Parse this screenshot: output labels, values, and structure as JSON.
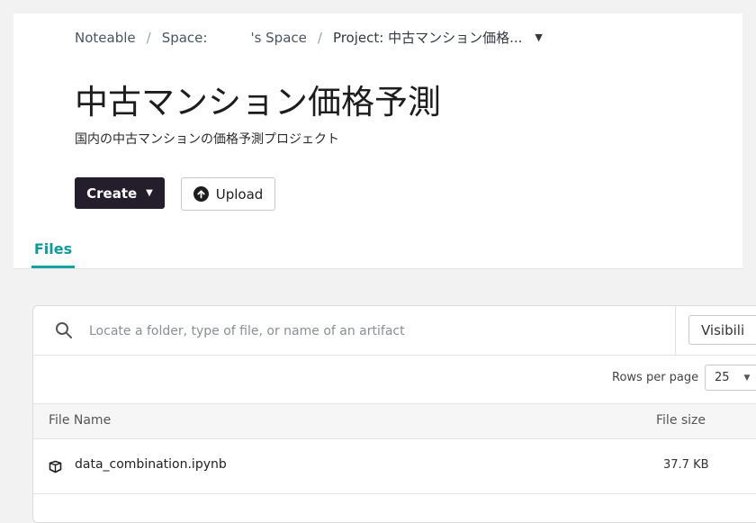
{
  "breadcrumb": {
    "home": "Noteable",
    "separator": "/",
    "space_prefix": "Space:",
    "space_suffix": "'s Space",
    "project": "Project: 中古マンション価格..."
  },
  "project": {
    "title": "中古マンション価格予測",
    "description": "国内の中古マンションの価格予測プロジェクト"
  },
  "actions": {
    "create_label": "Create",
    "upload_label": "Upload"
  },
  "tabs": [
    {
      "label": "Files",
      "active": true
    }
  ],
  "files_panel": {
    "search_placeholder": "Locate a folder, type of file, or name of an artifact",
    "visibility_label": "Visibili",
    "rows_per_page_label": "Rows per page",
    "rows_per_page_value": "25",
    "columns": {
      "name": "File Name",
      "size": "File size"
    },
    "rows": [
      {
        "name": "data_combination.ipynb",
        "size": "37.7 KB",
        "icon": "notebook-icon"
      }
    ]
  },
  "colors": {
    "accent": "#14a3a0",
    "primary_button": "#241e2c",
    "page_background": "#f2f2f2"
  },
  "icons": {
    "search": "search-icon",
    "upload": "arrow-up-circle-icon",
    "dropdown": "caret-down-icon",
    "file": "notebook-icon"
  }
}
